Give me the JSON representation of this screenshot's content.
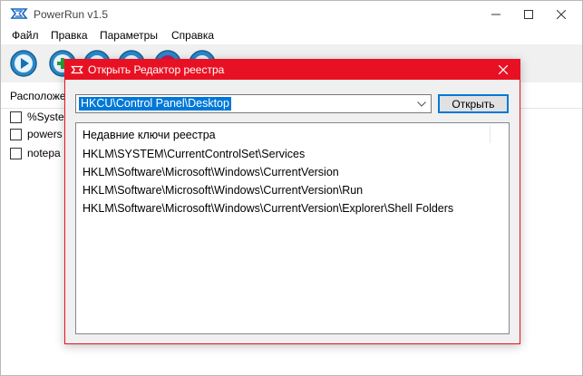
{
  "app": {
    "title": "PowerRun v1.5"
  },
  "menu": [
    "Файл",
    "Правка",
    "Параметры",
    "Справка"
  ],
  "toolbar": {
    "icons": [
      "run-icon",
      "add-icon",
      "settings-icon",
      "settings-icon",
      "admin-icon",
      "settings-icon"
    ]
  },
  "list": {
    "header": "Расположе",
    "rows": [
      "%Syste",
      "powers",
      "notepa"
    ]
  },
  "dialog": {
    "title": "Открыть Редактор реестра",
    "path_value": "HKCU\\Control Panel\\Desktop",
    "open_label": "Открыть",
    "recent_header": "Недавние ключи реестра",
    "recent_keys": [
      "HKLM\\SYSTEM\\CurrentControlSet\\Services",
      "HKLM\\Software\\Microsoft\\Windows\\CurrentVersion",
      "HKLM\\Software\\Microsoft\\Windows\\CurrentVersion\\Run",
      "HKLM\\Software\\Microsoft\\Windows\\CurrentVersion\\Explorer\\Shell Folders"
    ]
  },
  "colors": {
    "accent_red": "#e81123",
    "selection_blue": "#0078d7"
  }
}
